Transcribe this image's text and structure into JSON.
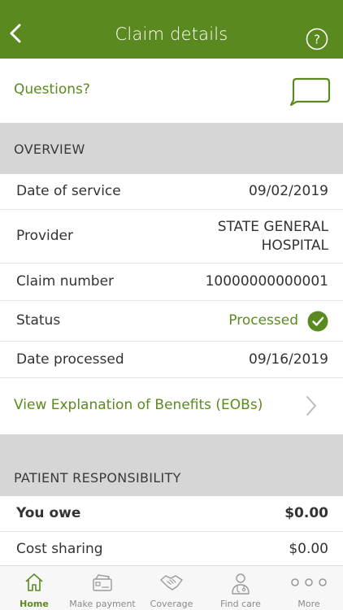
{
  "header": {
    "title": "Claim details",
    "back_icon": "chevron-left-icon",
    "help_icon": "question-circle-icon"
  },
  "questions": {
    "label": "Questions?",
    "icon": "chat-bubble-icon"
  },
  "overview": {
    "heading": "OVERVIEW",
    "rows": [
      {
        "label": "Date of service",
        "value": "09/02/2019"
      },
      {
        "label": "Provider",
        "value_line1": "STATE GENERAL",
        "value_line2": "HOSPITAL"
      },
      {
        "label": "Claim number",
        "value": "10000000000001"
      },
      {
        "label": "Status",
        "value": "Processed",
        "icon": "check-circle-icon"
      },
      {
        "label": "Date processed",
        "value": "09/16/2019"
      }
    ],
    "eob_link": "View Explanation of Benefits (EOBs)"
  },
  "patient_responsibility": {
    "heading": "PATIENT RESPONSIBILITY",
    "rows": [
      {
        "label": "You owe",
        "value": "$0.00"
      },
      {
        "label": "Cost sharing",
        "value": "$0.00"
      }
    ]
  },
  "tabbar": {
    "tabs": [
      {
        "label": "Home",
        "icon": "home-icon",
        "active": true
      },
      {
        "label": "Make payment",
        "icon": "payment-card-icon"
      },
      {
        "label": "Coverage",
        "icon": "handshake-icon"
      },
      {
        "label": "Find care",
        "icon": "doctor-icon"
      },
      {
        "label": "More",
        "icon": "more-dots-icon"
      }
    ]
  },
  "colors": {
    "brand_green": "#5a8a1f",
    "section_gray": "#d6d6d6",
    "tab_inactive": "#8a8a8a"
  }
}
